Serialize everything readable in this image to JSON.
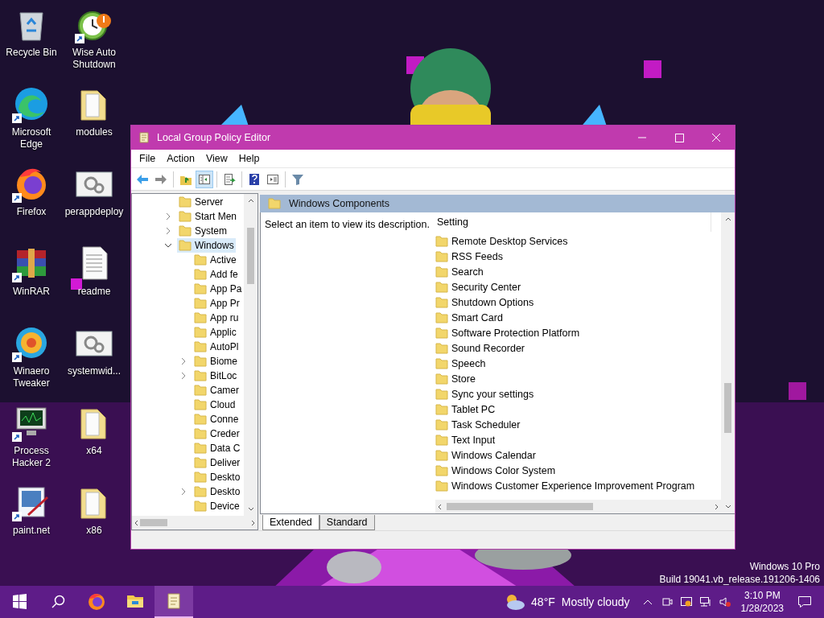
{
  "desktop_icons": [
    {
      "label": "Recycle Bin",
      "kind": "recycle",
      "shortcut": false
    },
    {
      "label": "Wise Auto Shutdown",
      "kind": "clock",
      "shortcut": true
    },
    {
      "label": "Microsoft Edge",
      "kind": "edge",
      "shortcut": true
    },
    {
      "label": "modules",
      "kind": "folder",
      "shortcut": false
    },
    {
      "label": "Firefox",
      "kind": "firefox",
      "shortcut": true
    },
    {
      "label": "perappdeploy",
      "kind": "gears",
      "shortcut": false
    },
    {
      "label": "WinRAR",
      "kind": "winrar",
      "shortcut": true
    },
    {
      "label": "readme",
      "kind": "textdoc",
      "shortcut": false
    },
    {
      "label": "Winaero Tweaker",
      "kind": "winaero",
      "shortcut": true
    },
    {
      "label": "systemwid...",
      "kind": "gears",
      "shortcut": false
    },
    {
      "label": "Process Hacker 2",
      "kind": "monitor",
      "shortcut": true
    },
    {
      "label": "x64",
      "kind": "folder",
      "shortcut": false
    },
    {
      "label": "paint.net",
      "kind": "paint",
      "shortcut": true
    },
    {
      "label": "x86",
      "kind": "folder",
      "shortcut": false
    }
  ],
  "window": {
    "title": "Local Group Policy Editor"
  },
  "menu": [
    "File",
    "Action",
    "View",
    "Help"
  ],
  "toolbar": [
    {
      "kind": "back",
      "selected": false
    },
    {
      "kind": "forward",
      "selected": false
    },
    {
      "kind": "separator"
    },
    {
      "kind": "up",
      "selected": false
    },
    {
      "kind": "tree",
      "selected": true
    },
    {
      "kind": "separator"
    },
    {
      "kind": "export",
      "selected": false
    },
    {
      "kind": "separator"
    },
    {
      "kind": "help",
      "selected": false
    },
    {
      "kind": "properties",
      "selected": false
    },
    {
      "kind": "separator"
    },
    {
      "kind": "filter",
      "selected": false
    }
  ],
  "tree": [
    {
      "label": "Server",
      "kind": "leaf",
      "selected": false
    },
    {
      "label": "Start Men",
      "kind": "collapsed",
      "selected": false
    },
    {
      "label": "System",
      "kind": "collapsed",
      "selected": false
    },
    {
      "label": "Windows",
      "kind": "expanded",
      "selected": true,
      "children": [
        {
          "label": "Active",
          "kind": "leaf",
          "selected": false
        },
        {
          "label": "Add fe",
          "kind": "leaf",
          "selected": false
        },
        {
          "label": "App Pa",
          "kind": "leaf",
          "selected": false
        },
        {
          "label": "App Pr",
          "kind": "leaf",
          "selected": false
        },
        {
          "label": "App ru",
          "kind": "leaf",
          "selected": false
        },
        {
          "label": "Applic",
          "kind": "leaf",
          "selected": false
        },
        {
          "label": "AutoPl",
          "kind": "leaf",
          "selected": false
        },
        {
          "label": "Biome",
          "kind": "collapsed",
          "selected": false
        },
        {
          "label": "BitLoc",
          "kind": "collapsed",
          "selected": false
        },
        {
          "label": "Camer",
          "kind": "leaf",
          "selected": false
        },
        {
          "label": "Cloud",
          "kind": "leaf",
          "selected": false
        },
        {
          "label": "Conne",
          "kind": "leaf",
          "selected": false
        },
        {
          "label": "Creder",
          "kind": "leaf",
          "selected": false
        },
        {
          "label": "Data C",
          "kind": "leaf",
          "selected": false
        },
        {
          "label": "Deliver",
          "kind": "leaf",
          "selected": false
        },
        {
          "label": "Deskto",
          "kind": "leaf",
          "selected": false
        },
        {
          "label": "Deskto",
          "kind": "collapsed",
          "selected": false
        },
        {
          "label": "Device",
          "kind": "leaf",
          "selected": false
        }
      ]
    }
  ],
  "details": {
    "header": "Windows Components",
    "description": "Select an item to view its description.",
    "column": "Setting",
    "settings": [
      "Remote Desktop Services",
      "RSS Feeds",
      "Search",
      "Security Center",
      "Shutdown Options",
      "Smart Card",
      "Software Protection Platform",
      "Sound Recorder",
      "Speech",
      "Store",
      "Sync your settings",
      "Tablet PC",
      "Task Scheduler",
      "Text Input",
      "Windows Calendar",
      "Windows Color System",
      "Windows Customer Experience Improvement Program"
    ]
  },
  "tabs": [
    {
      "label": "Extended",
      "selected": true
    },
    {
      "label": "Standard",
      "selected": false
    }
  ],
  "os_info": [
    "Windows 10 Pro",
    "Build 19041.vb_release.191206-1406"
  ],
  "taskbar": {
    "apps": [
      {
        "kind": "firefox",
        "selected": false
      },
      {
        "kind": "explorer",
        "selected": false
      },
      {
        "kind": "gpedit",
        "selected": true
      }
    ],
    "weather": {
      "temp": "48°F",
      "condition": "Mostly cloudy"
    },
    "time": "3:10 PM",
    "date": "1/28/2023"
  }
}
